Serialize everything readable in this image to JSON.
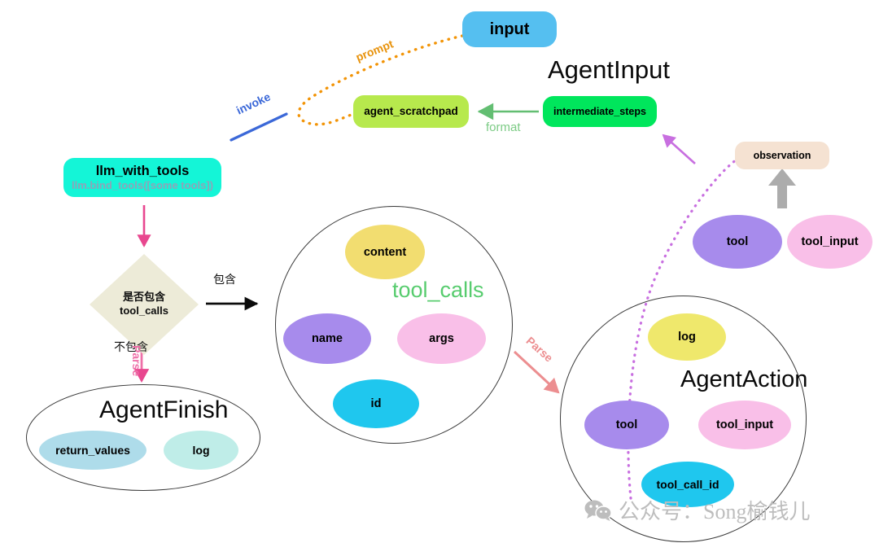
{
  "diagram": {
    "title_agentinput": "AgentInput",
    "title_agentfinish": "AgentFinish",
    "title_agentaction": "AgentAction",
    "title_toolcalls": "tool_calls"
  },
  "nodes": {
    "input": {
      "label": "input",
      "color": "#55BFF0"
    },
    "agent_scratchpad": {
      "label": "agent_scratchpad",
      "color": "#B7E94D"
    },
    "intermediate_steps": {
      "label": "intermediate_steps",
      "color": "#00E65C"
    },
    "llm_with_tools": {
      "label": "llm_with_tools",
      "sublabel": "llm.bind_tools([some tools])",
      "color": "#14F5D7",
      "sub_color": "#8FA3B8"
    },
    "observation": {
      "label": "observation",
      "color": "#F5E2D2"
    },
    "decision": {
      "line1": "是否包含",
      "line2": "tool_calls",
      "color": "#EDEBD8"
    }
  },
  "tool_calls_members": [
    {
      "label": "content",
      "color": "#F2DD70"
    },
    {
      "label": "name",
      "color": "#A78BEC"
    },
    {
      "label": "args",
      "color": "#F9BFE8"
    },
    {
      "label": "id",
      "color": "#1FC7EE"
    }
  ],
  "agent_action_members": [
    {
      "label": "log",
      "color": "#EFE86C"
    },
    {
      "label": "tool",
      "color": "#A78BEC"
    },
    {
      "label": "tool_input",
      "color": "#F9BFE8"
    },
    {
      "label": "tool_call_id",
      "color": "#1FC7EE"
    }
  ],
  "agent_finish_members": [
    {
      "label": "return_values",
      "color": "#AEDCEA"
    },
    {
      "label": "log",
      "color": "#BFEDE8"
    }
  ],
  "detached_members": [
    {
      "label": "tool",
      "color": "#A78BEC"
    },
    {
      "label": "tool_input",
      "color": "#F9BFE8"
    }
  ],
  "edges": {
    "prompt": {
      "label": "prompt",
      "color": "#E8930D",
      "style": "dotted"
    },
    "invoke": {
      "label": "invoke",
      "color": "#3B68D8",
      "style": "solid"
    },
    "format": {
      "label": "format",
      "color": "#7CCB85",
      "style": "solid-arrow"
    },
    "contains": {
      "label": "包含",
      "color": "#111111",
      "style": "solid-arrow"
    },
    "not_contains": {
      "label": "不包含",
      "color": "#111111",
      "style": "none"
    },
    "parse_down": {
      "label": "Parse",
      "color": "#EE6FA8",
      "style": "solid-arrow"
    },
    "parse_right": {
      "label": "Parse",
      "color": "#EC8E90",
      "style": "solid-arrow"
    },
    "bind": {
      "label": "",
      "color": "#E8478F",
      "style": "solid-arrow"
    },
    "observe": {
      "label": "",
      "color": "#A0A0A0",
      "style": "thick-arrow"
    },
    "feedback": {
      "label": "",
      "color": "#C86FE0",
      "style": "dotted-arrow"
    }
  },
  "watermark": {
    "text": "公众号：Song榆钱儿",
    "icon": "wechat-icon",
    "color": "#BDBDBD"
  }
}
